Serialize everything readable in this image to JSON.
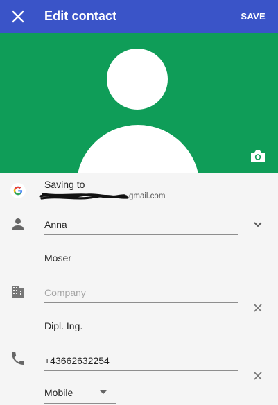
{
  "appbar": {
    "title": "Edit contact",
    "save_label": "SAVE",
    "close_icon": "close-icon",
    "background": "#3a54c8"
  },
  "photo": {
    "background": "#0f9d58",
    "camera_icon": "camera-icon"
  },
  "account": {
    "label": "Saving to",
    "email_visible": "gmail.com",
    "icon": "google-g-icon"
  },
  "name": {
    "icon": "person-icon",
    "first": "Anna",
    "last": "Moser"
  },
  "organization": {
    "icon": "building-icon",
    "company_placeholder": "Company",
    "company_value": "",
    "title": "Dipl. Ing."
  },
  "phone": {
    "icon": "phone-icon",
    "number": "+43662632254",
    "type": "Mobile"
  }
}
